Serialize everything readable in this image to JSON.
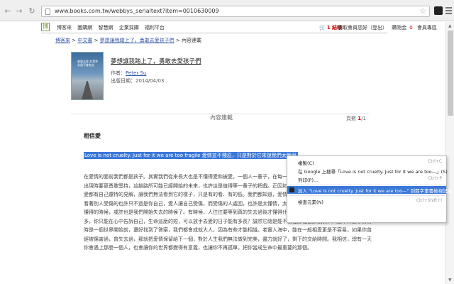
{
  "browser": {
    "url": "www.books.com.tw/webbys_serialtext?item=0010630009"
  },
  "site": {
    "logo": "博",
    "top_links": [
      "博客來",
      "圖購網",
      "智慧網",
      "企業採購",
      "福利平台"
    ],
    "cart_count": "1",
    "cart_label": "結帳",
    "account": "讀取會員您好（登出）",
    "coupon_label": "購物金",
    "coupon_value": "0",
    "member_center": "會員專區"
  },
  "breadcrumb": {
    "home": "博客來",
    "category": "中文書",
    "book": "夢想讓我踏上了，勇敢去愛孩子們",
    "current": "內容連載"
  },
  "book": {
    "title": "夢想讓我踏上了，勇敢去愛孩子們",
    "author_label": "作者：",
    "author": "Peter Su",
    "date_label": "出版日期：",
    "date": "2014/04/03",
    "cover_caption": "勇敢去愛 於是你永遠不會老去"
  },
  "preview": {
    "title": "內容連載",
    "page_label": "頁數",
    "page_current": "1",
    "page_total": "/1"
  },
  "content": {
    "section_title": "相信愛",
    "highlighted": "Love is not cruelty. Just for it we are too fragile 愛情並不殘忍，只是對於它來說我們太脆弱。",
    "paragraph": "在愛情的面前我們都是孩子。其實我們從來長大也是不懂得愛和被愛。一個人一輩子，在每一段一個時候就再也無法相合，當愛開始出現時要更勇敢堅持，這趟路所可能已經開始的未來，也許這是值得等一輩子的把戲。正因如此，隨著世界還轉的改變，卻讓人對於愛都有自己還特的見解，讓我們無法看到它的樣子，只是有的看、有的低。我們都知道，愛情推沒有對錯，殘忍的人選擇傷害別人，看著別人受傷的也許只不過是你自己，愛人讓自己受傷，而受傷的人處回，也許是太懂情，太衝動，寂寞，付出多了。當你開始真正懂得的時候，或許也是我們開始失去的時候了。有時候，人往往要等到真的失去過後才懂得什麼是珍惜，誰都不例外。走過了那那多，你只能在心中告訴自己，生命這麼的短，可以放手去愛的日子能有多長？誠然它總是能不斷在那裡告訴我們，人生中什麼事情有時是一個世界開始前，還好找到了答案，我們都會成就大人，因為有些才能相識。老實人海中，能在一般相愛更是不容易，如果你曾經被傷害過，曾失去過，那就把愛情保留給下一個，對於人生我們無法做到完美，盡力就好了，剩下的交給時間。我相信，總有一天你會遇上那麼一個人，也會讓你的世界都變得有意義，也讓你不再孤單。把你當成生命中最重要的那個。"
  },
  "context_menu": {
    "items": [
      {
        "label": "複製(C)",
        "shortcut": "Ctrl+C"
      },
      {
        "label": "在 Google 上搜尋「Love is not cruelty. Just for it we are too—」(S)",
        "shortcut": ""
      },
      {
        "label": "列印(P)...",
        "shortcut": "Ctrl+P"
      },
      {
        "label": "加入 \"Love is not cruelty. Just for it we are too—\" 到閱字筆書檢視記錄",
        "shortcut": ""
      },
      {
        "label": "檢查元素(N)",
        "shortcut": "Ctrl+Shift+I"
      }
    ]
  }
}
